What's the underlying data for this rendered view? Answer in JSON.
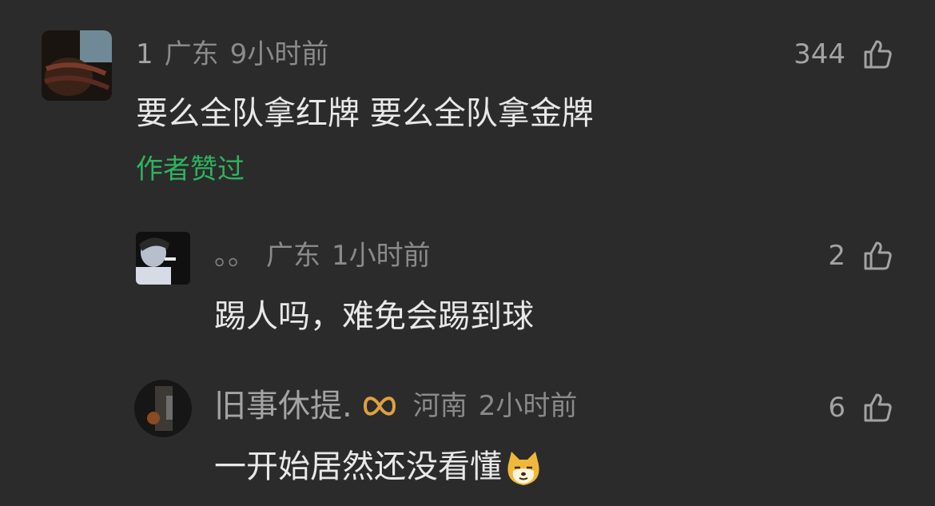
{
  "comments": [
    {
      "username": "1",
      "location": "广东",
      "time": "9小时前",
      "likes": "344",
      "text": "要么全队拿红牌 要么全队拿金牌",
      "author_liked": "作者赞过",
      "avatar_icon": "avatar-dark-photo"
    }
  ],
  "replies": [
    {
      "username": "。。",
      "location": "广东",
      "time": "1小时前",
      "likes": "2",
      "text": "踢人吗，难免会踢到球",
      "avatar_icon": "avatar-boy-photo"
    },
    {
      "username": "旧事休提.",
      "badge_icon": "infinity-badge-icon",
      "location": "河南",
      "time": "2小时前",
      "likes": "6",
      "text": "一开始居然还没看懂",
      "emoji_icon": "doge-emoji",
      "avatar_icon": "avatar-night-photo"
    }
  ],
  "colors": {
    "background": "#2b2b2b",
    "author_liked": "#2fb25e",
    "badge": "#e0a040"
  }
}
